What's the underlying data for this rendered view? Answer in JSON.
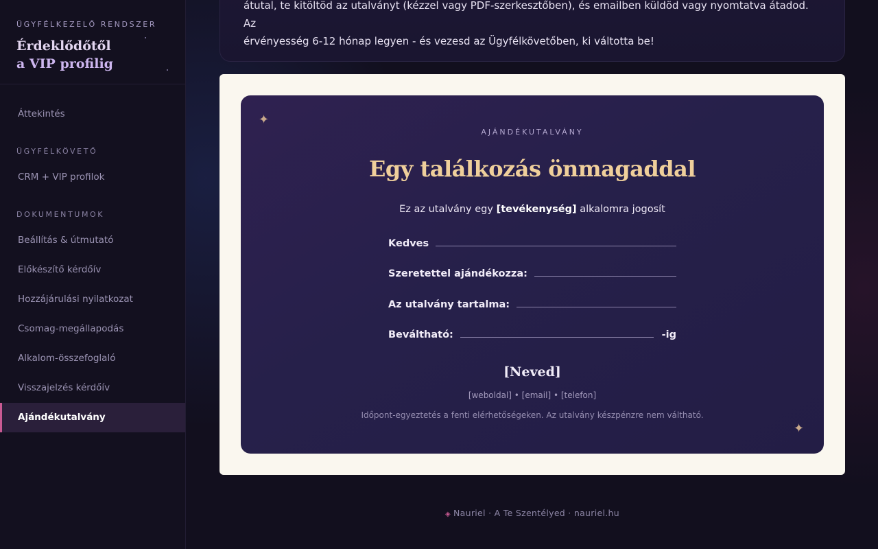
{
  "sidebar": {
    "kicker": "ÜGYFÉLKEZELŐ RENDSZER",
    "title_line1": "Érdeklődőtől",
    "title_line2": "a VIP profilig",
    "items": {
      "overview": "Áttekintés",
      "section_tracker": "ÜGYFÉLKÖVETŐ",
      "crm": "CRM + VIP profilok",
      "section_docs": "DOKUMENTUMOK",
      "setup": "Beállítás & útmutató",
      "prep": "Előkészítő kérdőív",
      "consent": "Hozzájárulási nyilatkozat",
      "package": "Csomag-megállapodás",
      "summary": "Alkalom-összefoglaló",
      "feedback": "Visszajelzés kérdőív",
      "voucher": "Ajándékutalvány"
    }
  },
  "intro": {
    "line1": "átutal, te kitöltöd az utalványt (kézzel vagy PDF-szerkesztőben), és emailben küldöd vagy nyomtatva átadod. Az",
    "line2": "érvényesség 6-12 hónap legyen - és vezesd az Ügyfélkövetőben, ki váltotta be!"
  },
  "voucher": {
    "kicker": "AJÁNDÉKUTALVÁNY",
    "title": "Egy találkozás önmagaddal",
    "sub_prefix": "Ez az utalvány egy ",
    "sub_bold": "[tevékenység]",
    "sub_suffix": " alkalomra jogosít",
    "field_dear": "Kedves",
    "field_gift_from": "Szeretettel ajándékozza:",
    "field_content": "Az utalvány tartalma:",
    "field_valid": "Beváltható:",
    "field_valid_suffix": "-ig",
    "name": "[Neved]",
    "contact": "[weboldal] • [email] • [telefon]",
    "note": "Időpont-egyeztetés a fenti elérhetőségeken. Az utalvány készpénzre nem váltható."
  },
  "footer": {
    "text": "Nauriel · A Te Szentélyed · nauriel.hu"
  },
  "icons": {
    "sparkle": "sparkle-icon",
    "gem": "diamond-icon"
  },
  "colors": {
    "accent": "#c95a93",
    "gold": "#efcf9b",
    "cert_bg": "#2a2150",
    "frame": "#faf7ef"
  }
}
